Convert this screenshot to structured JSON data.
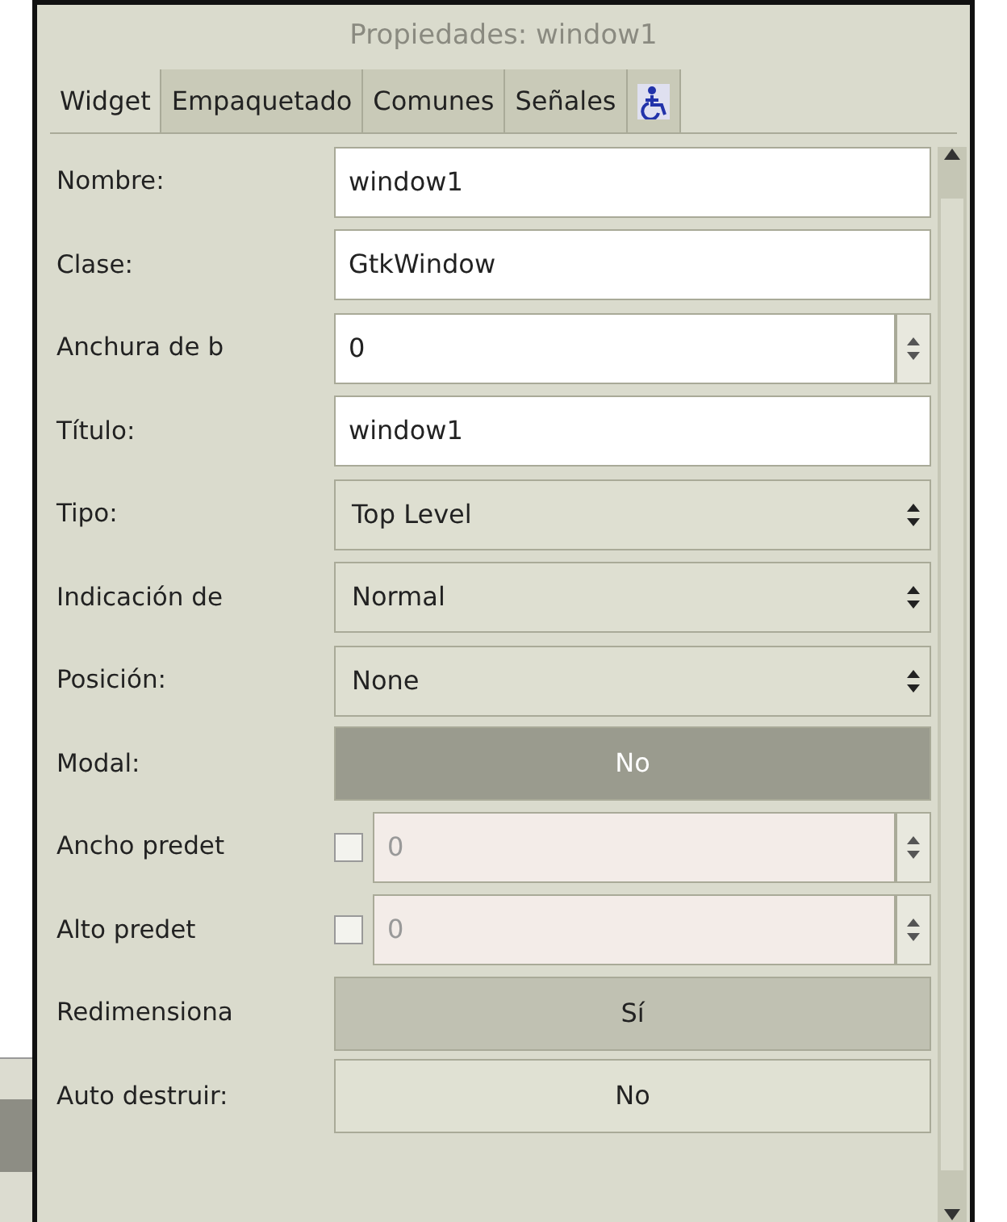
{
  "window": {
    "title": "Propiedades: window1"
  },
  "tabs": [
    {
      "label": "Widget",
      "selected": true
    },
    {
      "label": "Empaquetado",
      "selected": false
    },
    {
      "label": "Comunes",
      "selected": false
    },
    {
      "label": "Señales",
      "selected": false
    },
    {
      "kind": "accessibility",
      "selected": false
    }
  ],
  "properties": [
    {
      "kind": "entry",
      "label": "Nombre:",
      "value": "window1"
    },
    {
      "kind": "entry",
      "label": "Clase:",
      "value": "GtkWindow"
    },
    {
      "kind": "spin",
      "label": "Anchura de b",
      "value": "0"
    },
    {
      "kind": "entry",
      "label": "Título:",
      "value": "window1"
    },
    {
      "kind": "combo",
      "label": "Tipo:",
      "value": "Top Level"
    },
    {
      "kind": "combo",
      "label": "Indicación de",
      "value": "Normal"
    },
    {
      "kind": "combo",
      "label": "Posición:",
      "value": "None"
    },
    {
      "kind": "toggle",
      "label": "Modal:",
      "value": "No",
      "pressed": false,
      "hover": true
    },
    {
      "kind": "check-spin",
      "label": "Ancho predet",
      "checked": false,
      "value": "0"
    },
    {
      "kind": "check-spin",
      "label": "Alto predet",
      "checked": false,
      "value": "0"
    },
    {
      "kind": "toggle",
      "label": "Redimensiona",
      "value": "Sí",
      "pressed": true,
      "hover": false
    },
    {
      "kind": "toggle",
      "label": "Auto destruir:",
      "value": "No",
      "pressed": false,
      "hover": false
    }
  ]
}
